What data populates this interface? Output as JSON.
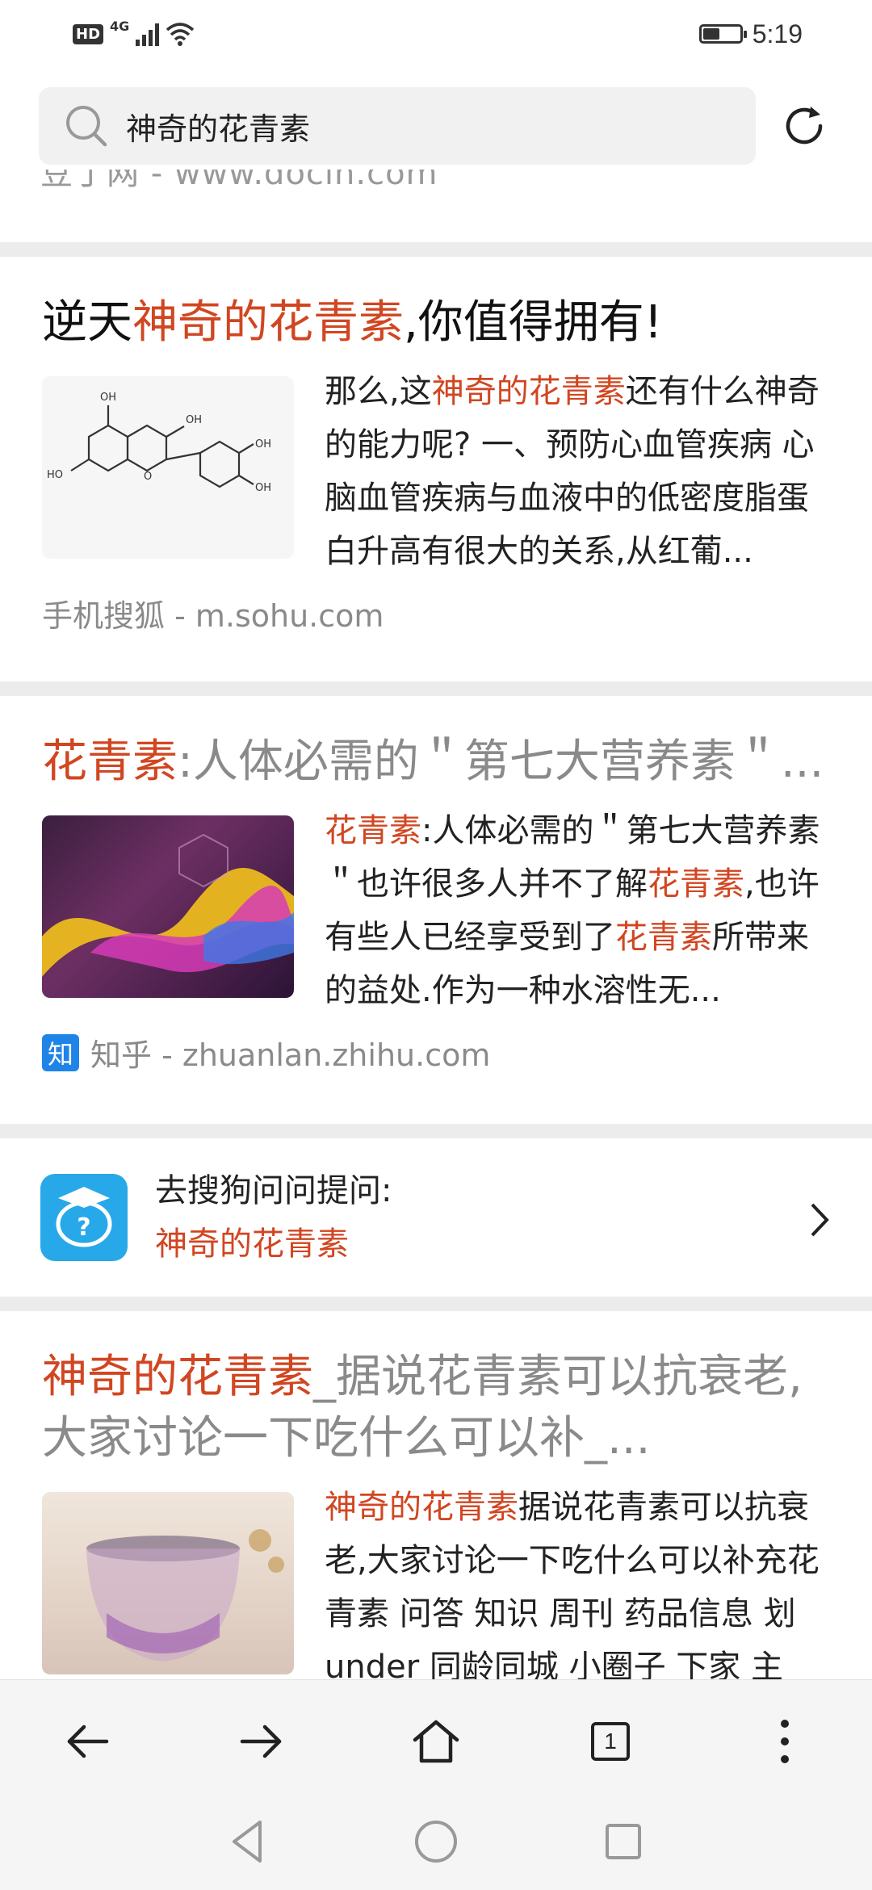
{
  "status_bar": {
    "hd": "HD",
    "network": "4G",
    "time": "5:19",
    "battery_level": 0.45
  },
  "search": {
    "query": "神奇的花青素"
  },
  "results": [
    {
      "partial_source": "豆丁网 - www.docin.com"
    },
    {
      "title_hl": "神奇的花青素",
      "title_pre": "逆天",
      "title_post": ",你值得拥有!",
      "snippet_pre": "那么,这",
      "snippet_hl": "神奇的花青素",
      "snippet_post": "还有什么神奇的能力呢? 一、预防心血管疾病 心脑血管疾病与血液中的低密度脂蛋白升高有很大的关系,从红葡...",
      "source": "手机搜狐 - m.sohu.com"
    },
    {
      "title_hl": "花青素",
      "title_post": ":人体必需的＂第七大营养素＂...",
      "snippet_hl1": "花青素",
      "snippet_mid1": ":人体必需的＂第七大营养素＂也许很多人并不了解",
      "snippet_hl2": "花青素",
      "snippet_mid2": ",也许有些人已经享受到了",
      "snippet_hl3": "花青素",
      "snippet_post": "所带来的益处.作为一种水溶性无...",
      "source_badge": "知",
      "source": "知乎 - zhuanlan.zhihu.com"
    },
    {
      "ask_line1": "去搜狗问问提问:",
      "ask_line2": "神奇的花青素"
    },
    {
      "title_hl": "神奇的花青素",
      "title_post": "_据说花青素可以抗衰老,大家讨论一下吃什么可以补_...",
      "snippet_hl": "神奇的花青素",
      "snippet_post": "据说花青素可以抗衰老,大家讨论一下吃什么可以补充花青素 问答 知识 周刊 药品信息 划under 同龄同城 小圈子 下家 主"
    }
  ],
  "bottom_nav": {
    "tab_count": "1"
  },
  "icons": [
    "search-icon",
    "refresh-icon",
    "back-icon",
    "forward-icon",
    "home-icon",
    "tabs-icon",
    "more-icon",
    "sys-back-icon",
    "sys-home-icon",
    "sys-recents-icon",
    "chevron-right-icon"
  ],
  "colors": {
    "highlight": "#d14621",
    "muted": "#8a8a8a",
    "zhihu_blue": "#1f84e8",
    "ask_blue": "#27a8e9"
  }
}
